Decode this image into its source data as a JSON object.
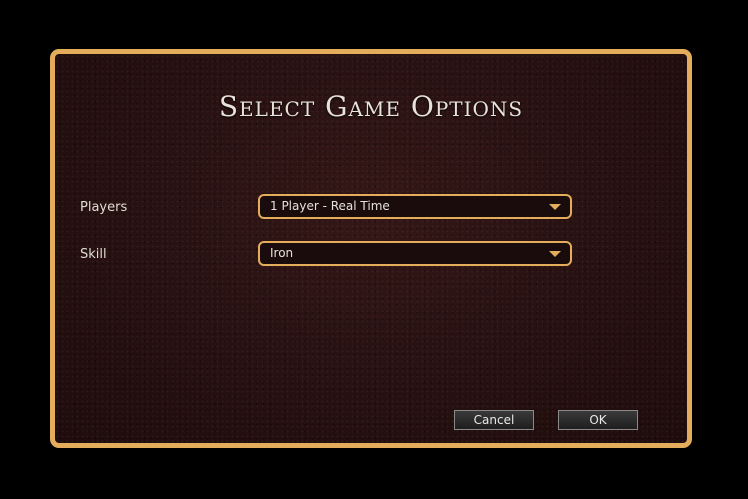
{
  "dialog": {
    "title": "Select Game Options"
  },
  "players": {
    "label": "Players",
    "value": "1 Player - Real Time",
    "icon": "chevron-down-icon"
  },
  "skill": {
    "label": "Skill",
    "value": "Iron",
    "icon": "chevron-down-icon"
  },
  "buttons": {
    "cancel": "Cancel",
    "ok": "OK"
  },
  "colors": {
    "accent": "#e3ad5b",
    "panel": "#2a1212",
    "background": "#000000"
  }
}
